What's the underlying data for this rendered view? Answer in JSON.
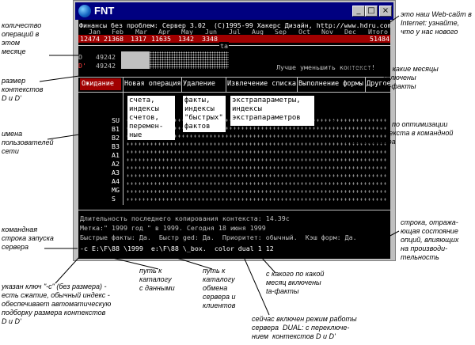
{
  "window": {
    "title": "FNT",
    "buttons": {
      "minimize": "_",
      "maximize": "□",
      "close": "×"
    }
  },
  "screen": {
    "header": "Финансы без проблем: Сервер 3.02  (C)1995-99 Хакерс Дизайн, http://www.hdru.com",
    "months": [
      "Jan",
      "Feb",
      "Mar",
      "Apr",
      "May",
      "Jun",
      "Jul",
      "Aug",
      "Sep",
      "Oct",
      "Nov",
      "Dec",
      "Итого"
    ],
    "counts": [
      "12474",
      "21368",
      "1317",
      "11635",
      "1342",
      "3348",
      "",
      "",
      "",
      "",
      "",
      "",
      "51484"
    ],
    "ta_label": "ta",
    "dsize_row": {
      "label": "D",
      "value": "49242"
    },
    "dprime_row": {
      "label": "D'",
      "value": "49242"
    },
    "advice": "Лучше уменьшить контекст!",
    "menu": [
      {
        "label": "Ожидание"
      },
      {
        "label": "Новая операция"
      },
      {
        "label": "Удаление"
      },
      {
        "label": "Извлечение списка"
      },
      {
        "label": "Выполнение формы"
      },
      {
        "label": "Другое"
      }
    ],
    "users": [
      "SU",
      "B1",
      "B2",
      "B3",
      "A1",
      "A2",
      "A3",
      "A4",
      "MG",
      "S"
    ],
    "status_lines": [
      "Длительность последнего копирования контекста: 14.39с",
      "Метка:\" 1999 год \" в 1999. Сегодня 18 июня 1999",
      "Быстрые факты: Да.  Быстр ged: Да.  Приоритет: обычный.  Кэш форм: Да."
    ],
    "cmdline": "-c E:\\F\\88 \\1999  e:\\F\\88 \\_box.  color dual 1 12"
  },
  "callouts": {
    "box1": "счета,\nиндексы\nсчетов,\nперемен-\nные",
    "box2": "факты,\nиндексы\n\"быстрых\"\nфактов",
    "box3": "экстрапараметры,\nиндексы\nэкстрапараметров"
  },
  "annotations": {
    "ops_count": "количество\nопераций в\nэтом\nмесяце",
    "context_size": "размер\nконтекстов\nD и D'",
    "user_names": "имена\nпользователей\nсети",
    "cmd_line": "командная\nстрока запуска\nсервера",
    "key_c": "указан ключ \"-c\" (без размера) -\nесть сжатие, обычный индекс -\nобеспечивает автоматическую\nподборку размера контекстов\nD и D'",
    "data_path": "путь к\nкаталогу\nс данными",
    "exchange_path": "путь к\nкаталогу\nобмена\nсервера и\nклиентов",
    "since_month": "с какого по какой\nмесяц включены\nta-факты",
    "dual_mode": "сейчас включен режим работы\nсервера  DUAL: с переключе-\nнием  контекстов D и D'",
    "website": "это наш Web-сайт в\nInternet: узнайте,\nчто у нас нового",
    "ta_months": "за какие месяцы\nвключены\nta-факты",
    "advice_ann": "рекомендации по оптимизации\nразмера контекста в командной\nстроке сервера",
    "status_ann": "строка, отража-\nющая состояние\nопций, влияющих\nна производи-\nтельность"
  }
}
